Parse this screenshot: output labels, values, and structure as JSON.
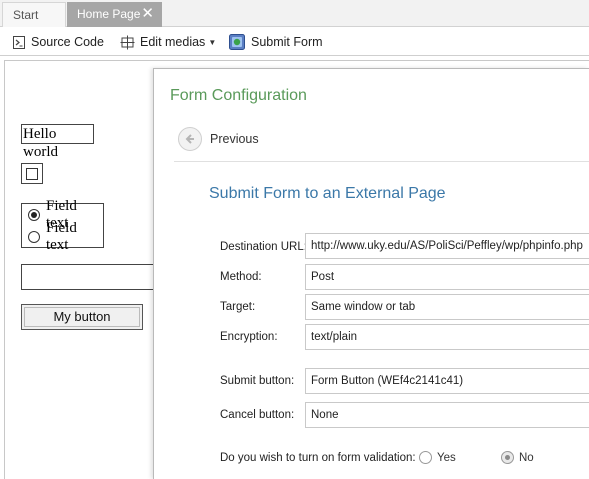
{
  "tabs": {
    "start": "Start",
    "home": "Home Page",
    "close_glyph": "✕"
  },
  "toolbar": {
    "source_code": "Source Code",
    "edit_medias": "Edit medias",
    "submit_form": "Submit Form"
  },
  "canvas": {
    "hello_text": "Hello world",
    "radio_option_1": "Field text",
    "radio_option_2": "Field text",
    "button_label": "My button"
  },
  "dialog": {
    "title": "Form Configuration",
    "previous": "Previous",
    "subtitle": "Submit Form to an External Page",
    "fields": {
      "destination_label": "Destination URL:",
      "destination_value": "http://www.uky.edu/AS/PoliSci/Peffley/wp/phpinfo.php",
      "method_label": "Method:",
      "method_value": "Post",
      "target_label": "Target:",
      "target_value": "Same window or tab",
      "encryption_label": "Encryption:",
      "encryption_value": "text/plain",
      "submit_button_label": "Submit button:",
      "submit_button_value": "Form Button (WEf4c2141c41)",
      "cancel_button_label": "Cancel button:",
      "cancel_button_value": "None"
    },
    "validation": {
      "question": "Do you wish to turn on form validation:",
      "yes": "Yes",
      "no": "No",
      "selected": "No"
    }
  },
  "colors": {
    "title_green": "#5a9a5a",
    "subtitle_blue": "#3b78a8",
    "active_tab": "#a6a6a6"
  },
  "icons": [
    "source-code-icon",
    "edit-medias-icon",
    "submit-form-icon",
    "previous-arrow-icon",
    "close-icon"
  ]
}
